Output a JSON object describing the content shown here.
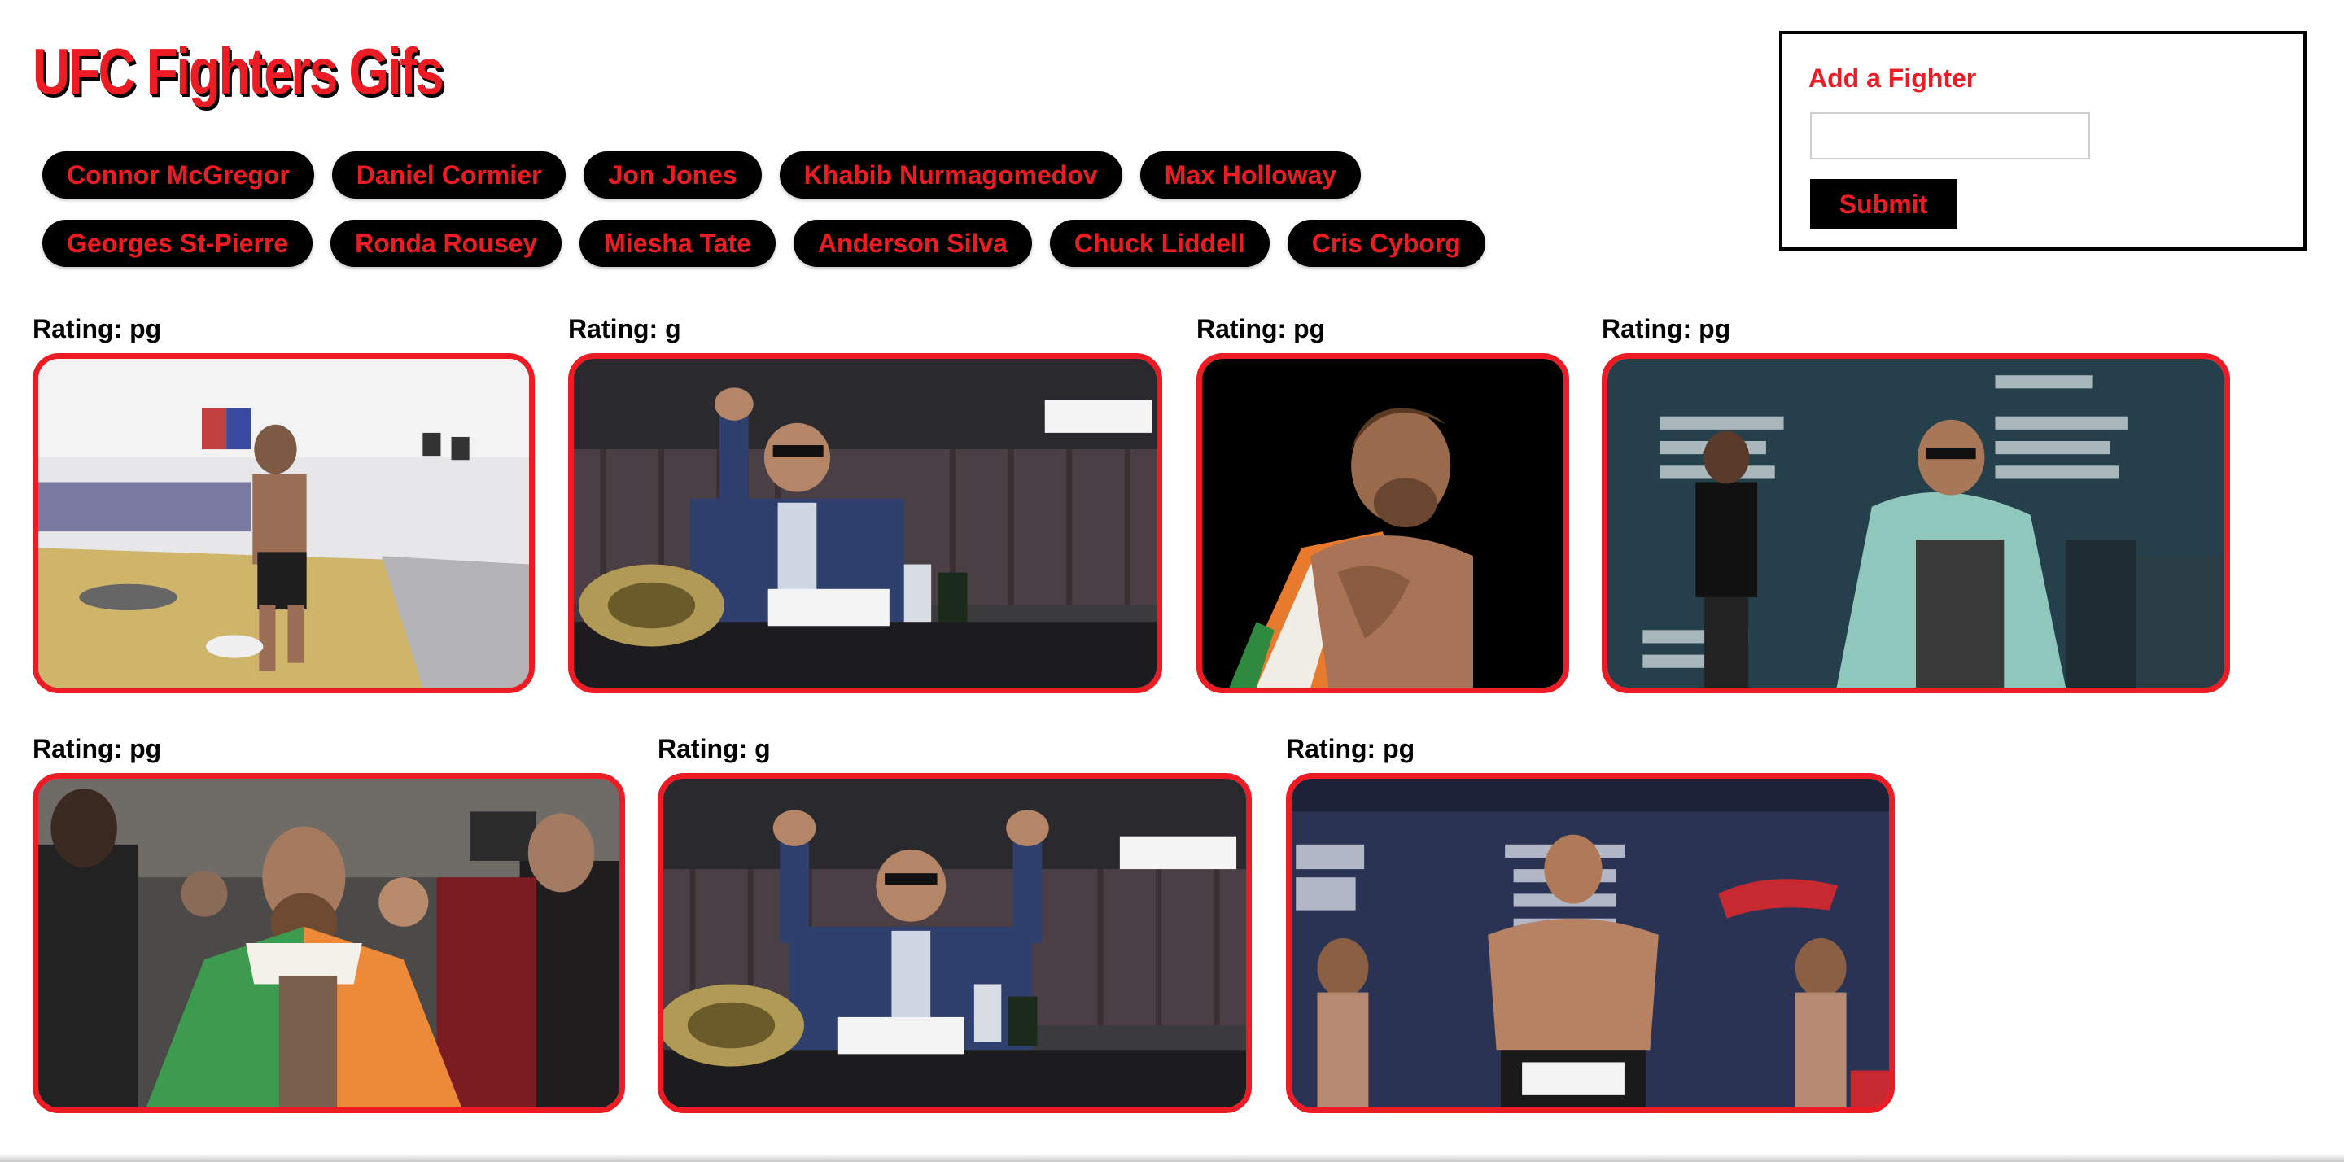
{
  "app": {
    "title": "UFC Fighters Gifs"
  },
  "fighters": {
    "row1": [
      "Connor McGregor",
      "Daniel Cormier",
      "Jon Jones",
      "Khabib Nurmagomedov",
      "Max Holloway"
    ],
    "row2": [
      "Georges St-Pierre",
      "Ronda Rousey",
      "Miesha Tate",
      "Anderson Silva",
      "Chuck Liddell",
      "Cris Cyborg"
    ]
  },
  "add_form": {
    "title": "Add a Fighter",
    "input_value": "",
    "submit_label": "Submit"
  },
  "gifs": [
    {
      "rating": "Rating: pg",
      "scene": "gym",
      "alt": "McGregor training gym"
    },
    {
      "rating": "Rating: g",
      "scene": "press1",
      "alt": "McGregor press conference fist"
    },
    {
      "rating": "Rating: pg",
      "scene": "flag-black",
      "alt": "McGregor with flag"
    },
    {
      "rating": "Rating: pg",
      "scene": "mayweather",
      "alt": "Mayweather vs McGregor press"
    },
    {
      "rating": "Rating: pg",
      "scene": "walkout",
      "alt": "McGregor walkout"
    },
    {
      "rating": "Rating: g",
      "scene": "press2",
      "alt": "McGregor press conference arms up"
    },
    {
      "rating": "Rating: pg",
      "scene": "weighin",
      "alt": "UFC 205 weigh-in"
    }
  ],
  "colors": {
    "accent": "#ed1c24",
    "button_bg": "#000000"
  }
}
